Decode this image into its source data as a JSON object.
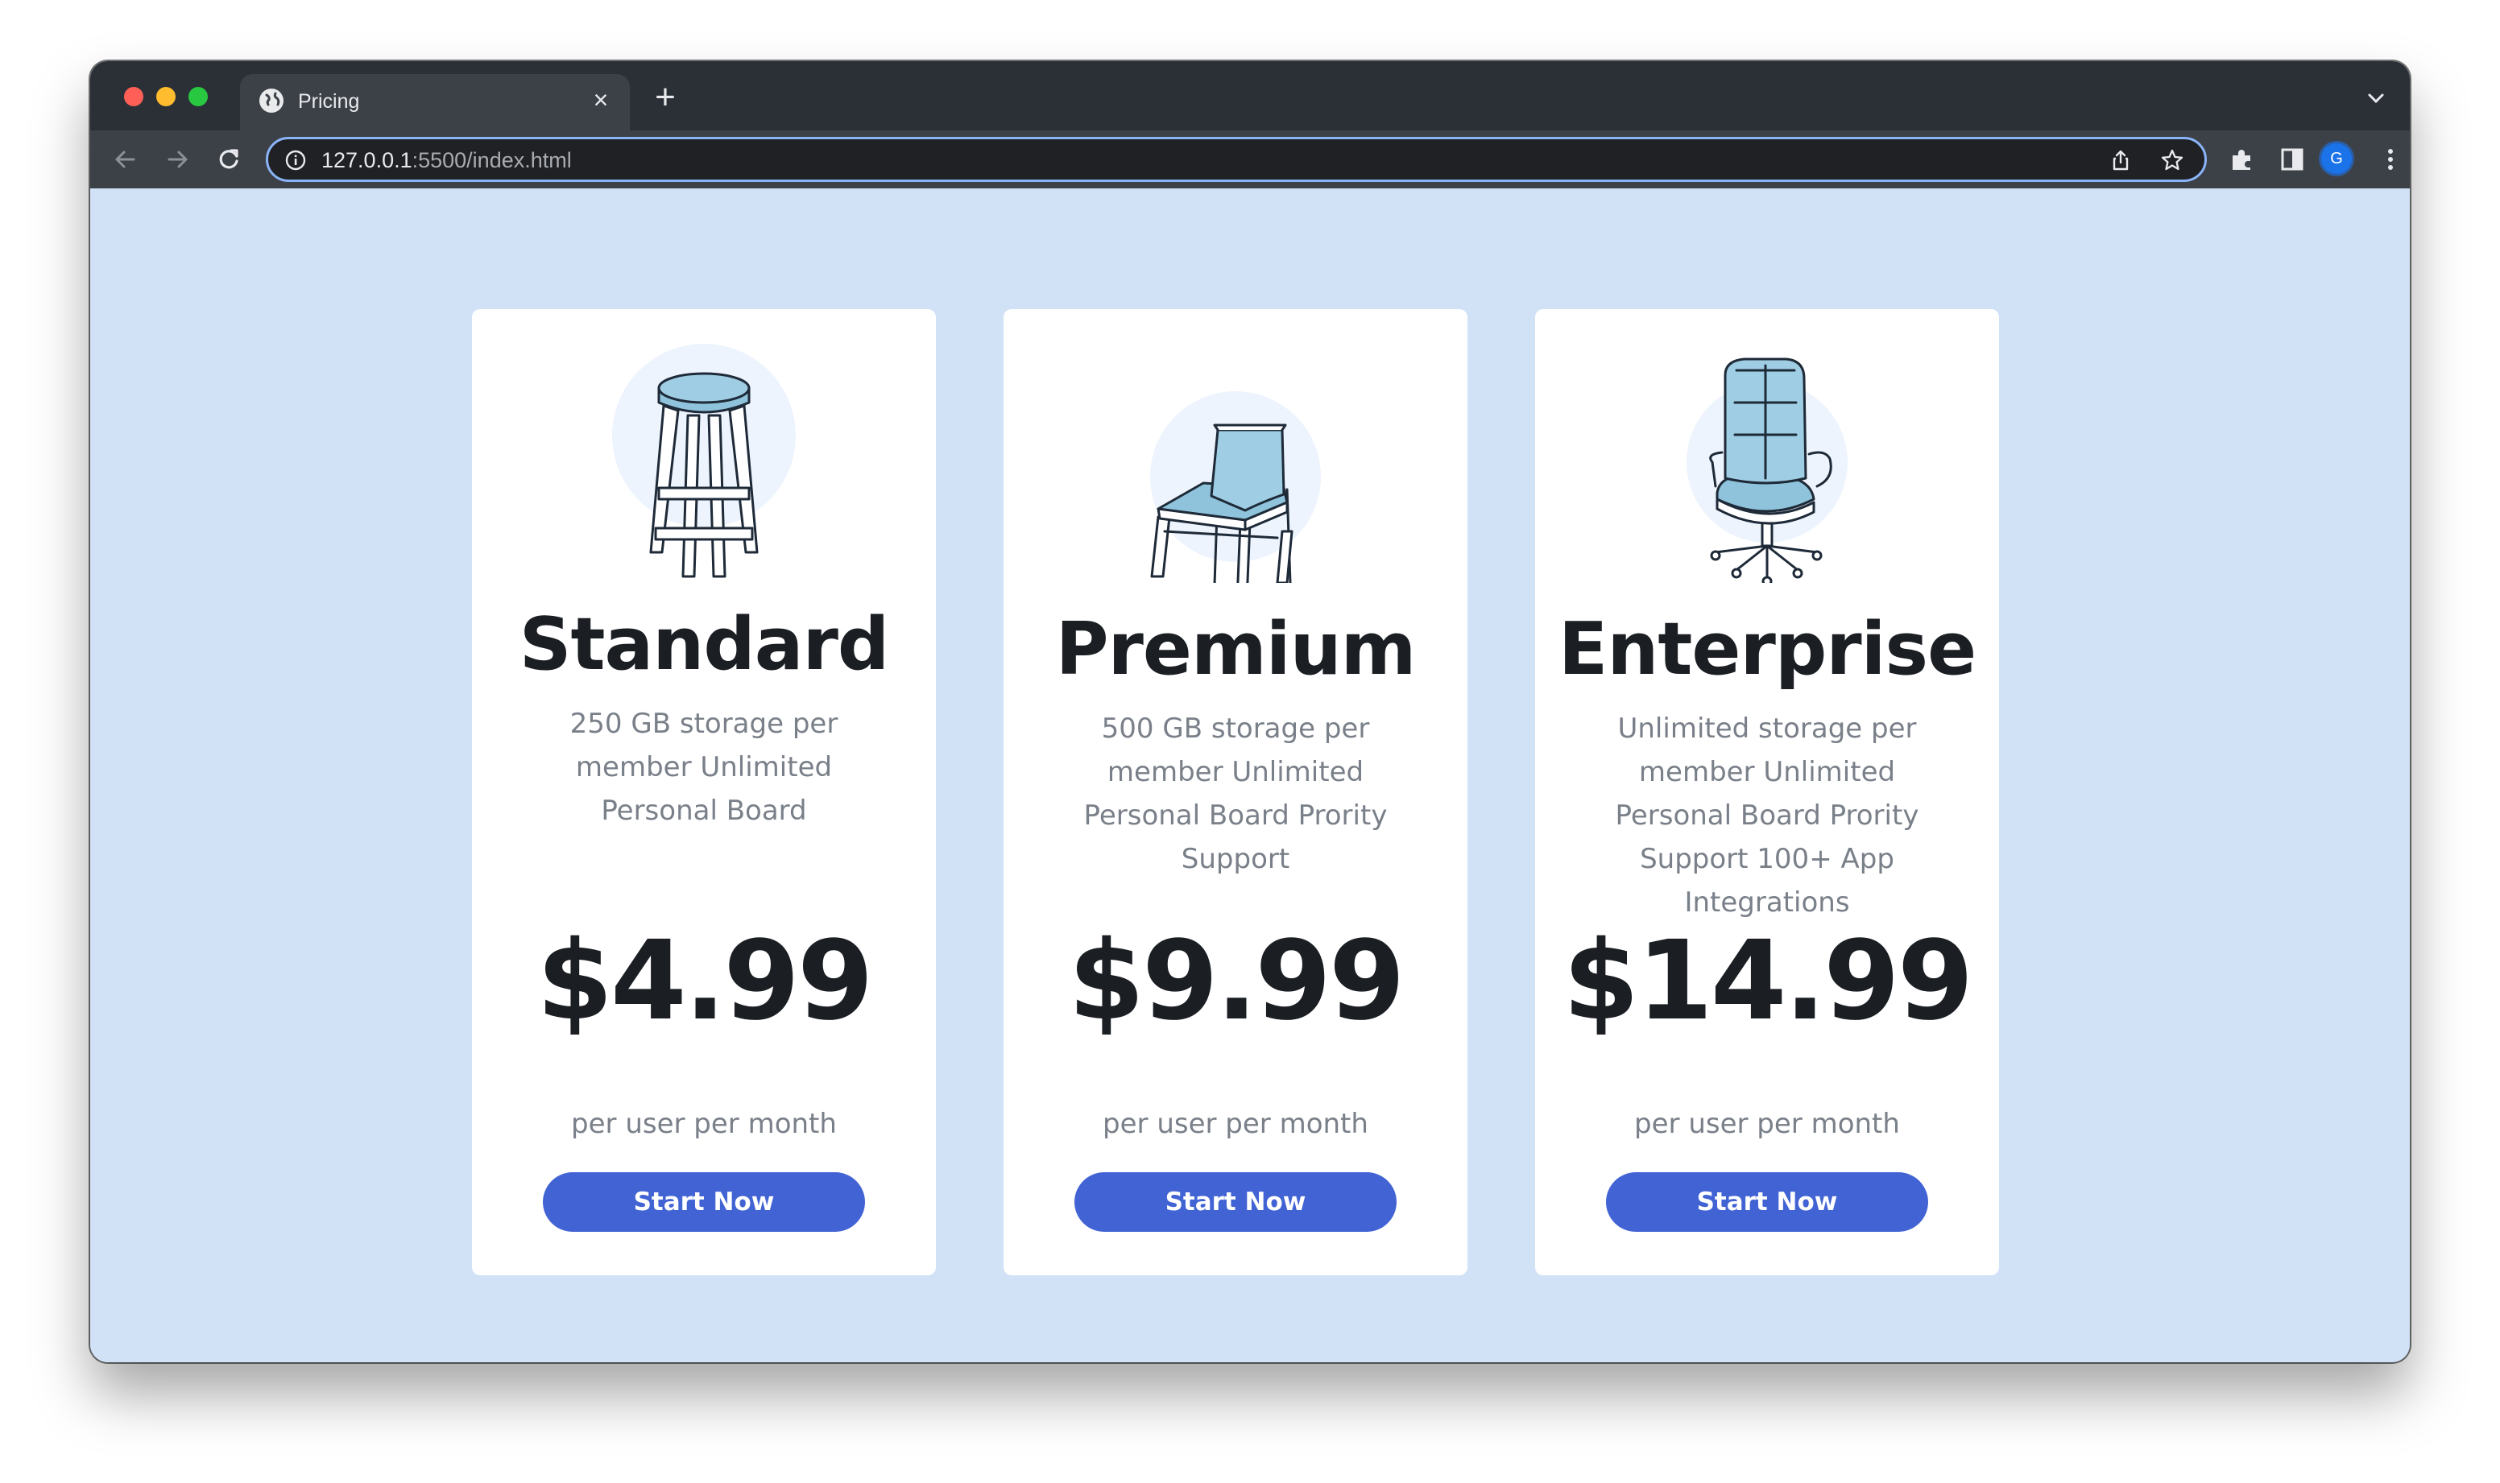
{
  "browser": {
    "tab_title": "Pricing",
    "url_host": "127.0.0.1",
    "url_rest": ":5500/index.html",
    "profile_initial": "G",
    "accent_color": "#8ab4f8"
  },
  "page": {
    "background_color": "#d1e2f7",
    "plans": [
      {
        "name": "Standard",
        "description": "250 GB storage per member Unlimited Personal Board",
        "price": "$4.99",
        "period": "per user per month",
        "cta_label": "Start Now",
        "illustration": "stool-icon"
      },
      {
        "name": "Premium",
        "description": "500 GB storage per member Unlimited Personal Board Prority Support",
        "price": "$9.99",
        "period": "per user per month",
        "cta_label": "Start Now",
        "illustration": "chair-icon"
      },
      {
        "name": "Enterprise",
        "description": "Unlimited storage per member Unlimited Personal Board Prority Support 100+ App Integrations",
        "price": "$14.99",
        "period": "per user per month",
        "cta_label": "Start Now",
        "illustration": "office-chair-icon"
      }
    ],
    "button_color": "#4263d4"
  }
}
